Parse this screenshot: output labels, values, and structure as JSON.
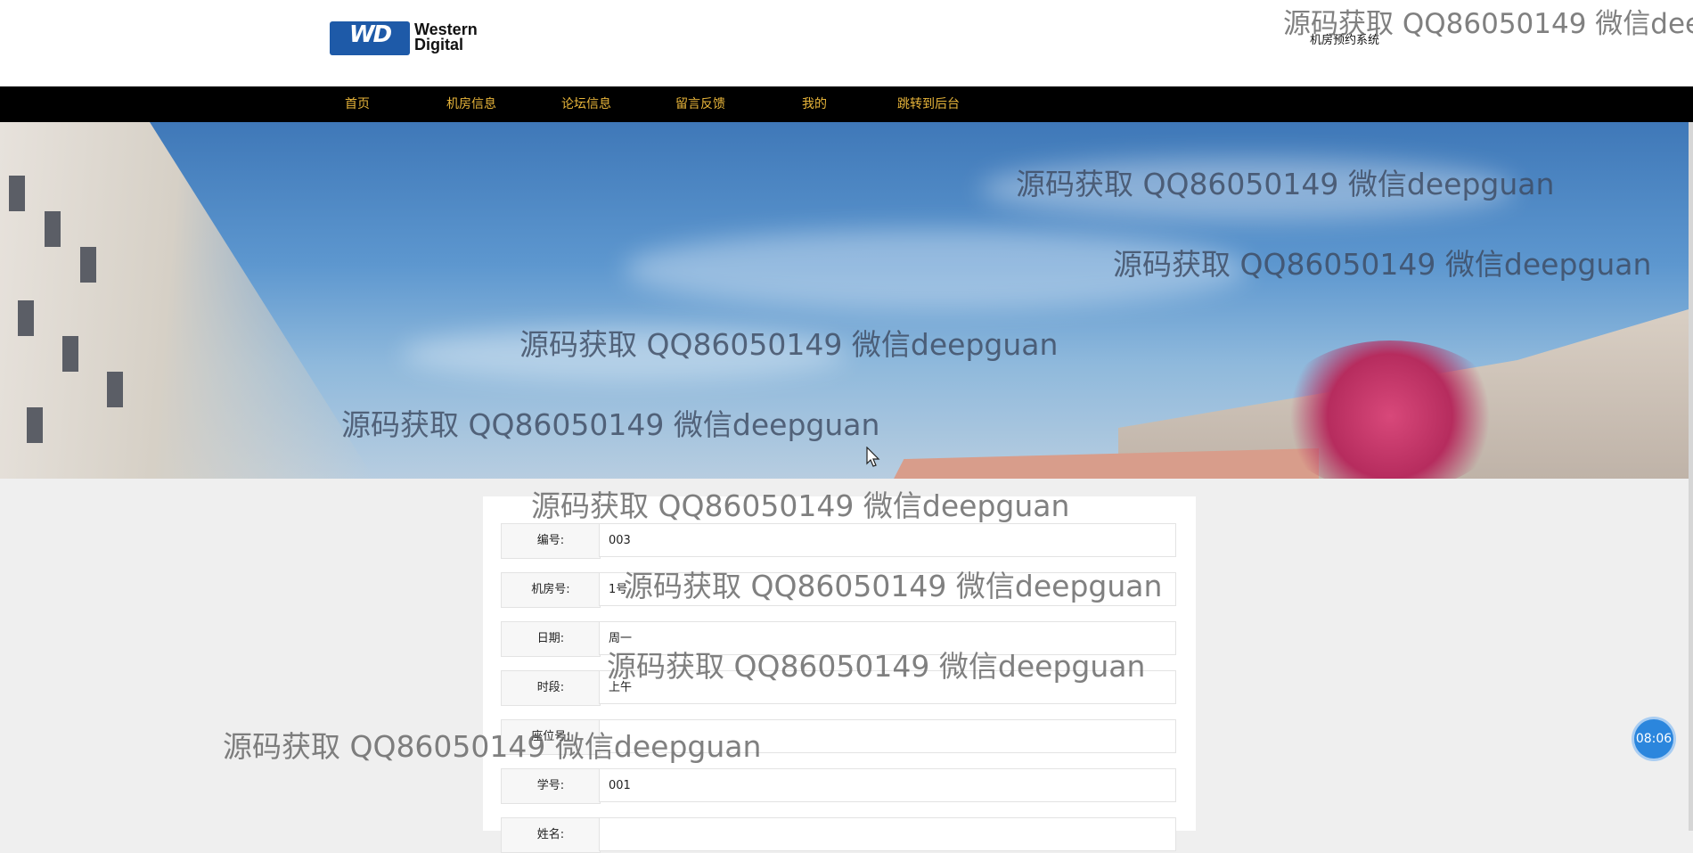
{
  "header": {
    "logo_word1": "Western",
    "logo_word2": "Digital",
    "logo_mark": "WD",
    "site_title": "机房预约系统"
  },
  "nav": {
    "items": [
      {
        "label": "首页"
      },
      {
        "label": "机房信息"
      },
      {
        "label": "论坛信息"
      },
      {
        "label": "留言反馈"
      },
      {
        "label": "我的"
      },
      {
        "label": "跳转到后台"
      }
    ]
  },
  "form": {
    "rows": [
      {
        "label": "编号:",
        "value": "003"
      },
      {
        "label": "机房号:",
        "value": "1号"
      },
      {
        "label": "日期:",
        "value": "周一"
      },
      {
        "label": "时段:",
        "value": "上午"
      },
      {
        "label": "座位号:",
        "value": ""
      },
      {
        "label": "学号:",
        "value": "001"
      },
      {
        "label": "姓名:",
        "value": ""
      }
    ]
  },
  "watermark": "源码获取 QQ86050149 微信deepguan",
  "clock": "08:06",
  "colors": {
    "nav_bg": "#000000",
    "nav_text": "#e8b53a",
    "accent": "#2b86dd"
  }
}
